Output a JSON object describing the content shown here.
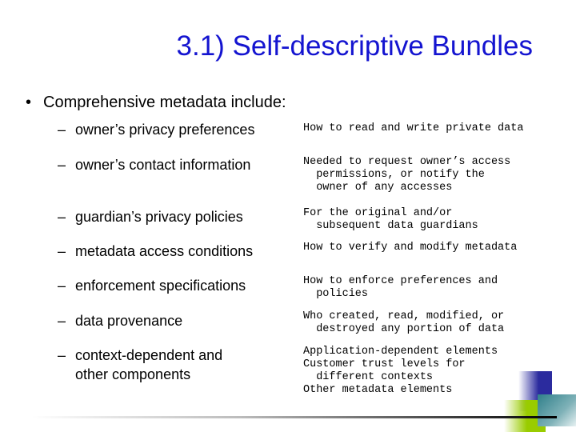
{
  "slide": {
    "title": "3.1) Self-descriptive Bundles",
    "bullet": "Comprehensive metadata include:",
    "bullet_icon": "bullet-dot",
    "sub_icon": "dash",
    "items": [
      {
        "label": [
          "owner’s privacy preferences"
        ],
        "description": "How to read and write private data"
      },
      {
        "label": [
          "owner’s contact information"
        ],
        "description": "Needed to request owner’s access\n  permissions, or notify the\n  owner of any accesses"
      },
      {
        "label": [
          "guardian’s privacy policies"
        ],
        "description": "For the original and/or\n  subsequent data guardians"
      },
      {
        "label": [
          "metadata access conditions"
        ],
        "description": "How to verify and modify metadata"
      },
      {
        "label": [
          "enforcement specifications"
        ],
        "description": "How to enforce preferences and\n  policies"
      },
      {
        "label": [
          "data provenance"
        ],
        "description": "Who created, read, modified, or\n  destroyed any portion of data"
      },
      {
        "label": [
          "context-dependent and",
          "other components"
        ],
        "description": "Application-dependent elements\nCustomer trust levels for\n  different contexts\nOther metadata elements"
      }
    ],
    "colors": {
      "title": "#1414d0",
      "deco_blue": "#2b2b9e",
      "deco_green": "#99cc00",
      "deco_teal": "#3a8a95"
    }
  }
}
